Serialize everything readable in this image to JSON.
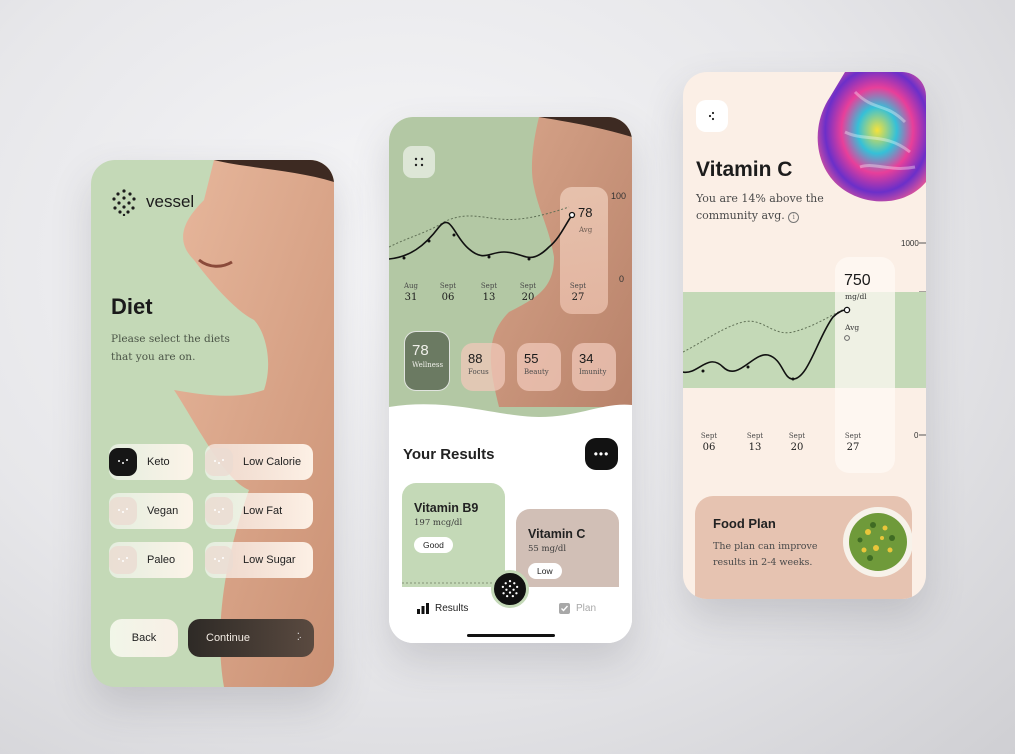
{
  "diet_screen": {
    "brand": "vessel",
    "title": "Diet",
    "subtitle": "Please select the diets that you are on.",
    "options": [
      {
        "label": "Keto",
        "selected": true
      },
      {
        "label": "Low Calorie",
        "selected": false
      },
      {
        "label": "Vegan",
        "selected": false
      },
      {
        "label": "Low Fat",
        "selected": false
      },
      {
        "label": "Paleo",
        "selected": false
      },
      {
        "label": "Low Sugar",
        "selected": false
      }
    ],
    "back_label": "Back",
    "continue_label": "Continue"
  },
  "results_screen": {
    "chart": {
      "y_max_label": "100",
      "y_min_label": "0",
      "current_value": "78",
      "avg_label": "Avg",
      "dates": [
        {
          "month": "Aug",
          "day": "31"
        },
        {
          "month": "Sept",
          "day": "06"
        },
        {
          "month": "Sept",
          "day": "13"
        },
        {
          "month": "Sept",
          "day": "20"
        },
        {
          "month": "Sept",
          "day": "27"
        }
      ]
    },
    "metrics": [
      {
        "value": "78",
        "label": "Wellness"
      },
      {
        "value": "88",
        "label": "Focus"
      },
      {
        "value": "55",
        "label": "Beauty"
      },
      {
        "value": "34",
        "label": "Imunity"
      }
    ],
    "section_title": "Your Results",
    "more_label": "•••",
    "cards": [
      {
        "title": "Vitamin B9",
        "value": "197 mcg/dl",
        "status": "Good"
      },
      {
        "title": "Vitamin C",
        "value": "55 mg/dl",
        "status": "Low"
      }
    ],
    "tabs": {
      "results": "Results",
      "plan": "Plan"
    }
  },
  "vitamin_screen": {
    "title": "Vitamin C",
    "subtitle": "You are 14% above the community avg.",
    "y_max_label": "1000",
    "y_min_label": "0",
    "current_value": "750",
    "unit": "mg/dl",
    "avg_label": "Avg",
    "dates": [
      {
        "month": "Sept",
        "day": "06"
      },
      {
        "month": "Sept",
        "day": "13"
      },
      {
        "month": "Sept",
        "day": "20"
      },
      {
        "month": "Sept",
        "day": "27"
      }
    ],
    "food_plan": {
      "title": "Food Plan",
      "subtitle": "The plan can improve results in 2-4 weeks."
    }
  },
  "colors": {
    "sage": "#c4d9b7",
    "sage_dark": "#6b7a62",
    "peach": "#e6c3b1",
    "cream": "#fbefe6",
    "ink": "#121212"
  }
}
